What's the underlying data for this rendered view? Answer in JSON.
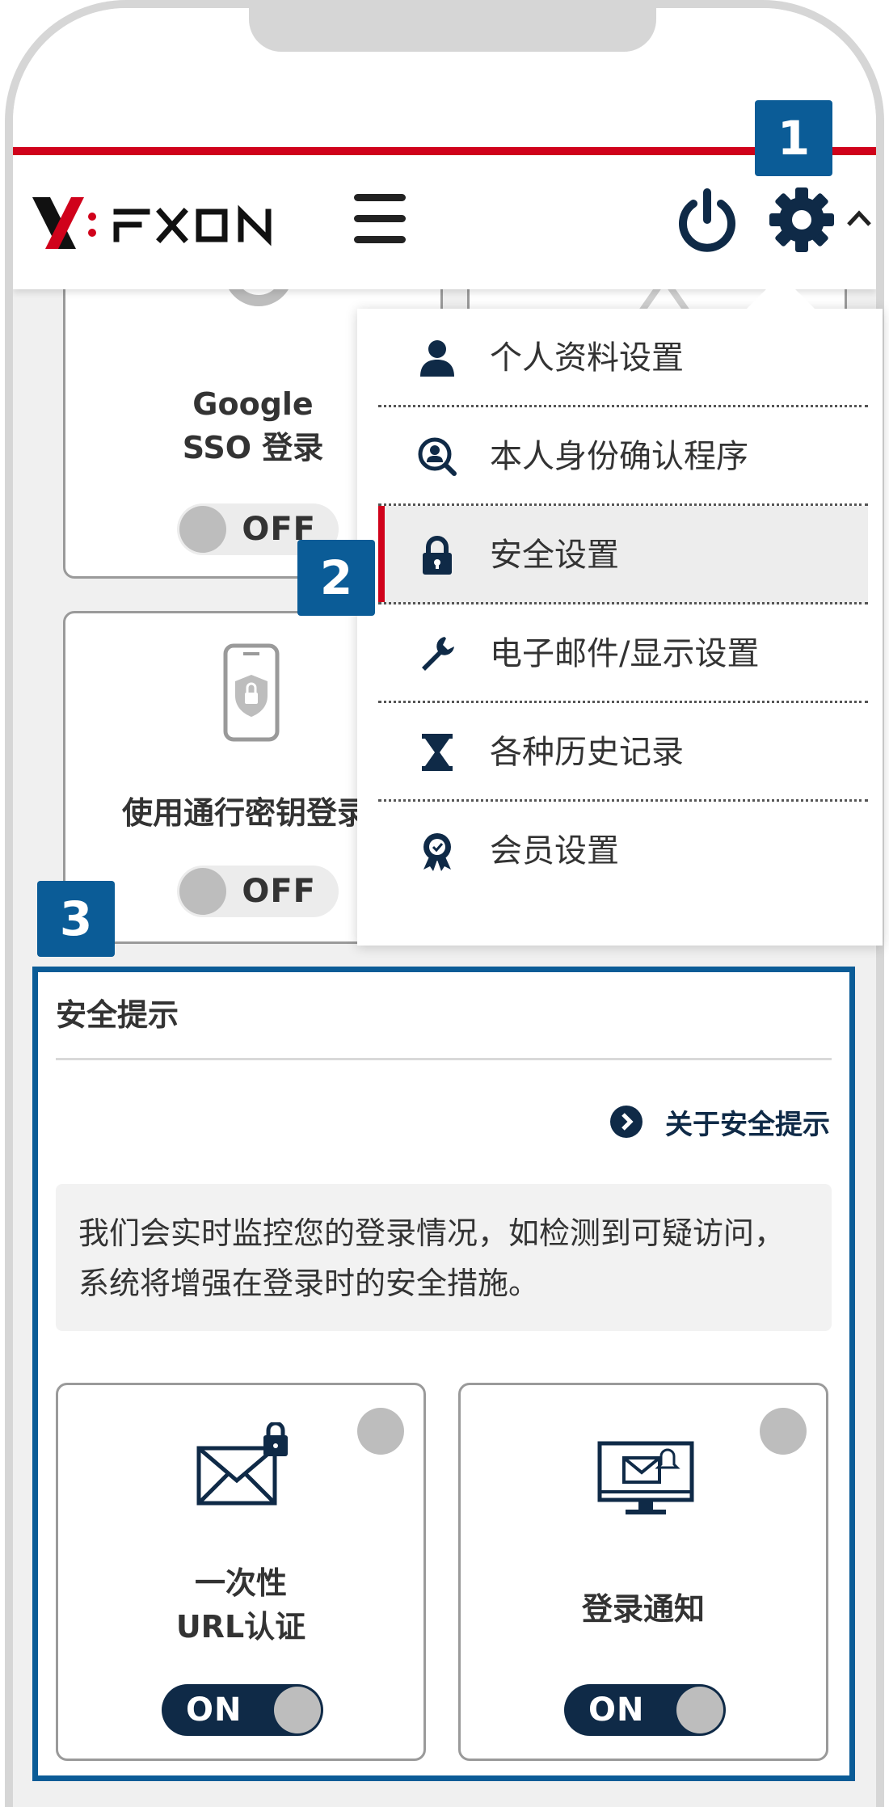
{
  "markers": [
    "1",
    "2",
    "3"
  ],
  "header": {
    "logo_alt": "FXON",
    "icons": [
      "hamburger-menu-icon",
      "power-icon",
      "gear-icon",
      "chevron-up-icon"
    ]
  },
  "cards": {
    "google_sso": {
      "title_line1": "Google",
      "title_line2": "SSO 登录",
      "toggle": "OFF"
    },
    "passkey": {
      "title": "使用通行密钥登录",
      "toggle": "OFF"
    }
  },
  "dropdown": {
    "items": [
      {
        "label": "个人资料设置",
        "icon": "person-icon"
      },
      {
        "label": "本人身份确认程序",
        "icon": "identity-search-icon"
      },
      {
        "label": "安全设置",
        "icon": "lock-icon",
        "active": true
      },
      {
        "label": "电子邮件/显示设置",
        "icon": "wrench-icon"
      },
      {
        "label": "各种历史记录",
        "icon": "hourglass-icon"
      },
      {
        "label": "会员设置",
        "icon": "badge-icon"
      }
    ]
  },
  "security": {
    "title": "安全提示",
    "link": "关于安全提示",
    "description": "我们会实时监控您的登录情况，如检测到可疑访问，系统将增强在登录时的安全措施。",
    "cards": [
      {
        "title_line1": "一次性",
        "title_line2": "URL认证",
        "toggle": "ON",
        "icon": "mail-lock-icon"
      },
      {
        "title": "登录通知",
        "toggle": "ON",
        "icon": "monitor-notification-icon"
      }
    ]
  },
  "colors": {
    "brand_red": "#d0021b",
    "marker_blue": "#0b5c97",
    "navy": "#0f2a47"
  }
}
